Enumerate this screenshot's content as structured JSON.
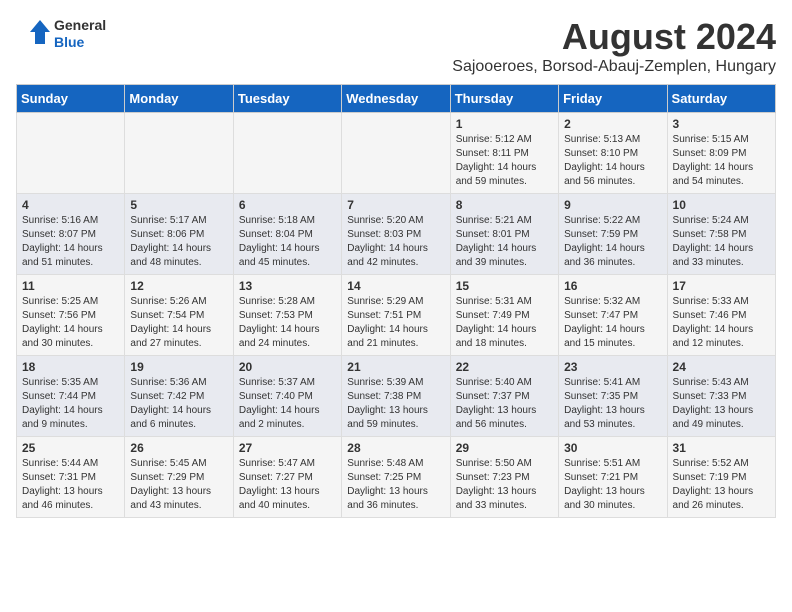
{
  "logo": {
    "line1": "General",
    "line2": "Blue"
  },
  "title": "August 2024",
  "subtitle": "Sajooeroes, Borsod-Abauj-Zemplen, Hungary",
  "days_of_week": [
    "Sunday",
    "Monday",
    "Tuesday",
    "Wednesday",
    "Thursday",
    "Friday",
    "Saturday"
  ],
  "weeks": [
    [
      {
        "day": "",
        "info": ""
      },
      {
        "day": "",
        "info": ""
      },
      {
        "day": "",
        "info": ""
      },
      {
        "day": "",
        "info": ""
      },
      {
        "day": "1",
        "info": "Sunrise: 5:12 AM\nSunset: 8:11 PM\nDaylight: 14 hours and 59 minutes."
      },
      {
        "day": "2",
        "info": "Sunrise: 5:13 AM\nSunset: 8:10 PM\nDaylight: 14 hours and 56 minutes."
      },
      {
        "day": "3",
        "info": "Sunrise: 5:15 AM\nSunset: 8:09 PM\nDaylight: 14 hours and 54 minutes."
      }
    ],
    [
      {
        "day": "4",
        "info": "Sunrise: 5:16 AM\nSunset: 8:07 PM\nDaylight: 14 hours and 51 minutes."
      },
      {
        "day": "5",
        "info": "Sunrise: 5:17 AM\nSunset: 8:06 PM\nDaylight: 14 hours and 48 minutes."
      },
      {
        "day": "6",
        "info": "Sunrise: 5:18 AM\nSunset: 8:04 PM\nDaylight: 14 hours and 45 minutes."
      },
      {
        "day": "7",
        "info": "Sunrise: 5:20 AM\nSunset: 8:03 PM\nDaylight: 14 hours and 42 minutes."
      },
      {
        "day": "8",
        "info": "Sunrise: 5:21 AM\nSunset: 8:01 PM\nDaylight: 14 hours and 39 minutes."
      },
      {
        "day": "9",
        "info": "Sunrise: 5:22 AM\nSunset: 7:59 PM\nDaylight: 14 hours and 36 minutes."
      },
      {
        "day": "10",
        "info": "Sunrise: 5:24 AM\nSunset: 7:58 PM\nDaylight: 14 hours and 33 minutes."
      }
    ],
    [
      {
        "day": "11",
        "info": "Sunrise: 5:25 AM\nSunset: 7:56 PM\nDaylight: 14 hours and 30 minutes."
      },
      {
        "day": "12",
        "info": "Sunrise: 5:26 AM\nSunset: 7:54 PM\nDaylight: 14 hours and 27 minutes."
      },
      {
        "day": "13",
        "info": "Sunrise: 5:28 AM\nSunset: 7:53 PM\nDaylight: 14 hours and 24 minutes."
      },
      {
        "day": "14",
        "info": "Sunrise: 5:29 AM\nSunset: 7:51 PM\nDaylight: 14 hours and 21 minutes."
      },
      {
        "day": "15",
        "info": "Sunrise: 5:31 AM\nSunset: 7:49 PM\nDaylight: 14 hours and 18 minutes."
      },
      {
        "day": "16",
        "info": "Sunrise: 5:32 AM\nSunset: 7:47 PM\nDaylight: 14 hours and 15 minutes."
      },
      {
        "day": "17",
        "info": "Sunrise: 5:33 AM\nSunset: 7:46 PM\nDaylight: 14 hours and 12 minutes."
      }
    ],
    [
      {
        "day": "18",
        "info": "Sunrise: 5:35 AM\nSunset: 7:44 PM\nDaylight: 14 hours and 9 minutes."
      },
      {
        "day": "19",
        "info": "Sunrise: 5:36 AM\nSunset: 7:42 PM\nDaylight: 14 hours and 6 minutes."
      },
      {
        "day": "20",
        "info": "Sunrise: 5:37 AM\nSunset: 7:40 PM\nDaylight: 14 hours and 2 minutes."
      },
      {
        "day": "21",
        "info": "Sunrise: 5:39 AM\nSunset: 7:38 PM\nDaylight: 13 hours and 59 minutes."
      },
      {
        "day": "22",
        "info": "Sunrise: 5:40 AM\nSunset: 7:37 PM\nDaylight: 13 hours and 56 minutes."
      },
      {
        "day": "23",
        "info": "Sunrise: 5:41 AM\nSunset: 7:35 PM\nDaylight: 13 hours and 53 minutes."
      },
      {
        "day": "24",
        "info": "Sunrise: 5:43 AM\nSunset: 7:33 PM\nDaylight: 13 hours and 49 minutes."
      }
    ],
    [
      {
        "day": "25",
        "info": "Sunrise: 5:44 AM\nSunset: 7:31 PM\nDaylight: 13 hours and 46 minutes."
      },
      {
        "day": "26",
        "info": "Sunrise: 5:45 AM\nSunset: 7:29 PM\nDaylight: 13 hours and 43 minutes."
      },
      {
        "day": "27",
        "info": "Sunrise: 5:47 AM\nSunset: 7:27 PM\nDaylight: 13 hours and 40 minutes."
      },
      {
        "day": "28",
        "info": "Sunrise: 5:48 AM\nSunset: 7:25 PM\nDaylight: 13 hours and 36 minutes."
      },
      {
        "day": "29",
        "info": "Sunrise: 5:50 AM\nSunset: 7:23 PM\nDaylight: 13 hours and 33 minutes."
      },
      {
        "day": "30",
        "info": "Sunrise: 5:51 AM\nSunset: 7:21 PM\nDaylight: 13 hours and 30 minutes."
      },
      {
        "day": "31",
        "info": "Sunrise: 5:52 AM\nSunset: 7:19 PM\nDaylight: 13 hours and 26 minutes."
      }
    ]
  ]
}
